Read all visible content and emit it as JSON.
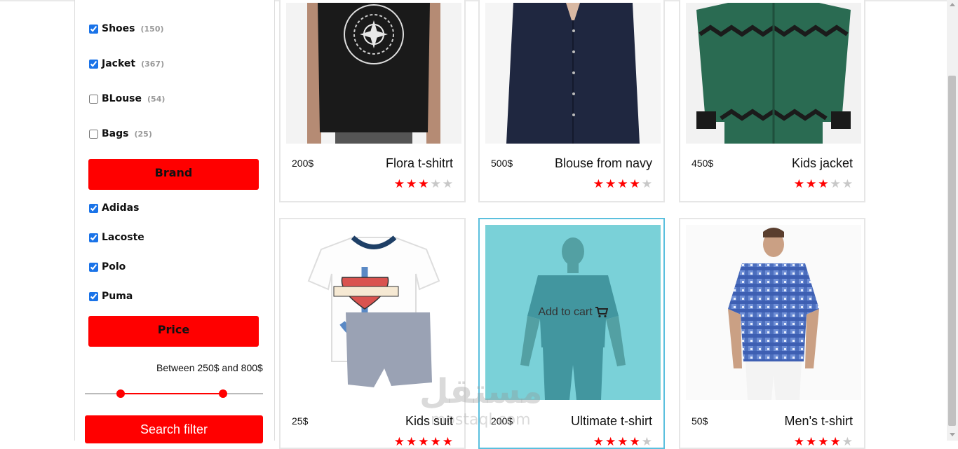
{
  "categories": [
    {
      "label": "Shoes",
      "count": "(150)",
      "checked": true
    },
    {
      "label": "Jacket",
      "count": "(367)",
      "checked": true
    },
    {
      "label": "BLouse",
      "count": "(54)",
      "checked": false
    },
    {
      "label": "Bags",
      "count": "(25)",
      "checked": false
    }
  ],
  "brand_heading": "Brand",
  "brands": [
    {
      "label": "Adidas",
      "checked": true
    },
    {
      "label": "Lacoste",
      "checked": true
    },
    {
      "label": "Polo",
      "checked": true
    },
    {
      "label": "Puma",
      "checked": true
    }
  ],
  "price_heading": "Price",
  "price_range_text": "Between 250$ and 800$",
  "price_range": {
    "min": 250,
    "max": 800
  },
  "search_button": "Search filter",
  "products": [
    {
      "name": "Flora t-shitrt",
      "price": "200$",
      "rating": 3
    },
    {
      "name": "Blouse from navy",
      "price": "500$",
      "rating": 4
    },
    {
      "name": "Kids jacket",
      "price": "450$",
      "rating": 3
    },
    {
      "name": "Kids suit",
      "price": "25$",
      "rating": 5
    },
    {
      "name": "Ultimate t-shirt",
      "price": "200$",
      "rating": 4,
      "hover_label": "Add to cart"
    },
    {
      "name": "Men's t-shirt",
      "price": "50$",
      "rating": 4
    }
  ],
  "watermark": {
    "text": "مستقل",
    "sub": "mostaql.com"
  },
  "colors": {
    "accent": "#ff0000",
    "highlight": "#5bc0de",
    "star_off": "#c8c8c8"
  }
}
